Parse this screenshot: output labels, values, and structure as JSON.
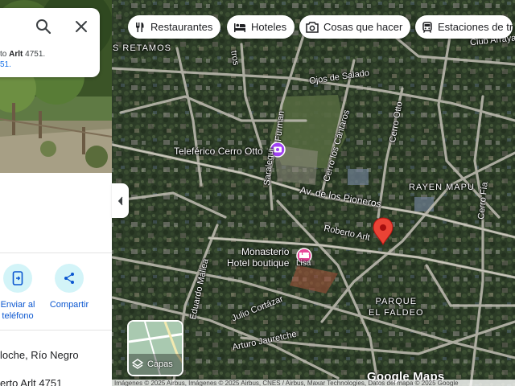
{
  "search": {
    "suggestion_prefix": "to ",
    "suggestion_street": "Arlt",
    "suggestion_number": " 4751.",
    "suggestion_second": "51."
  },
  "chips": [
    {
      "label": "Restaurantes",
      "icon": "fork-knife-icon"
    },
    {
      "label": "Hoteles",
      "icon": "bed-icon"
    },
    {
      "label": "Cosas que hacer",
      "icon": "camera-icon"
    },
    {
      "label": "Estaciones de tr",
      "icon": "train-icon"
    }
  ],
  "panel": {
    "actions": [
      {
        "label_line1": "Enviar al",
        "label_line2": "teléfono",
        "icon": "send-to-phone-icon"
      },
      {
        "label_line1": "Compartir",
        "label_line2": "",
        "icon": "share-icon"
      }
    ],
    "info": [
      {
        "text": "loche, Río Negro",
        "icon": ""
      },
      {
        "text": "erto Arlt 4751",
        "icon": ""
      }
    ]
  },
  "map": {
    "labels": {
      "retamos": "S RETAMOS",
      "ojos_de_salado": "Ojos de Salado",
      "saralegui": "Saralegui",
      "furman": "Furman",
      "teleferico": "Teleférico Cerro Otto",
      "cerro_los_cantaros": "Cerro los Cántaros",
      "cerro_otto_street": "Cerro Otto",
      "av_pioneros": "Av. de los Pioneros",
      "rayen_mapu": "RAYEN MAPU",
      "cerro_fia": "Cerro Fía",
      "roberto_arlt": "Roberto Arlt",
      "monasterio": "Monasterio",
      "hotel_boutique": "Hotel boutique",
      "lisa": "Lisa",
      "parque_faldeo": "PARQUE\nEL FALDEO",
      "parque_line1": "PARQUE",
      "parque_line2": "EL FALDEO",
      "julio_cortazar": "Julio Cortázar",
      "arturo_jauretche": "Arturo Jauretche",
      "eduardo_mallea": "Eduardo Mallea",
      "club": "Club Arrayan",
      "cerros": "rros",
      "tros": "tros"
    },
    "pin_color": "#ea4335"
  },
  "layers_label": "Capas",
  "google_maps": "Google Maps",
  "attribution": "Imágenes © 2025 Airbus, Imágenes © 2025 Airbus, CNES / Airbus, Maxar Technologies, Datos del mapa © 2025 Google"
}
